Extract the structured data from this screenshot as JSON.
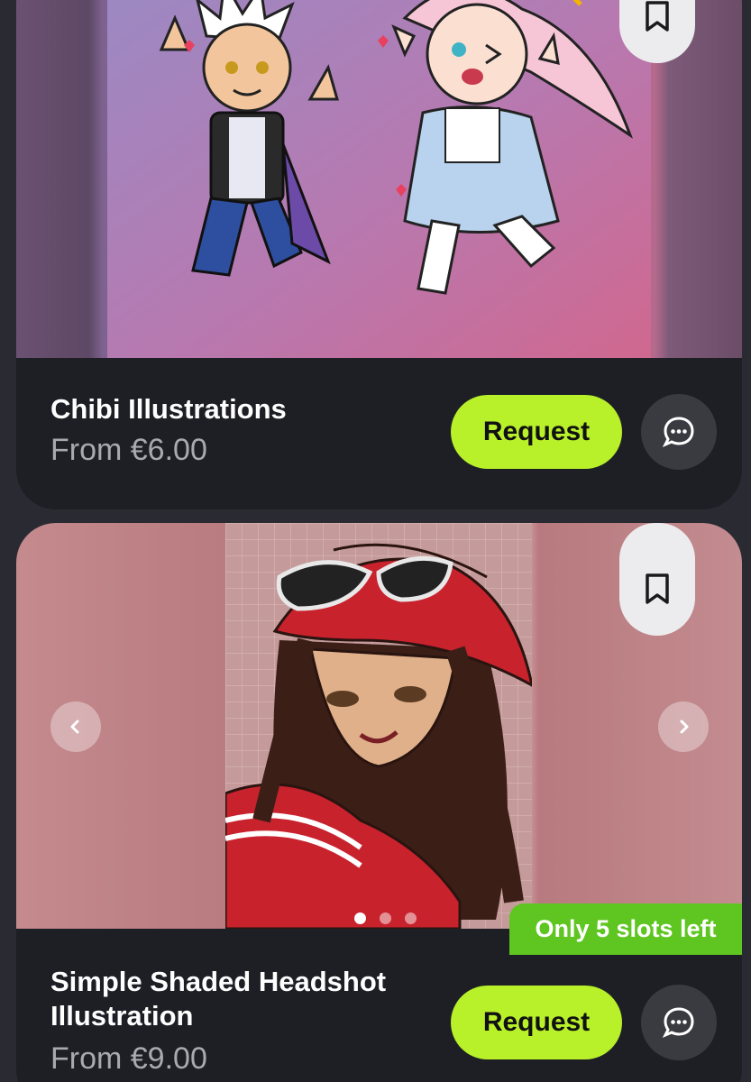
{
  "listings": [
    {
      "title": "Chibi Illustrations",
      "price": "From €6.00",
      "request_label": "Request",
      "icons": [
        "bookmark-icon",
        "chat-bubble-icon"
      ]
    },
    {
      "title": "Simple Shaded Headshot Illustration",
      "price": "From €9.00",
      "request_label": "Request",
      "badge": "Only 5 slots left",
      "carousel": {
        "slides": 3,
        "active_index": 0
      },
      "icons": [
        "bookmark-icon",
        "chevron-left-icon",
        "chevron-right-icon",
        "chat-bubble-icon"
      ]
    }
  ],
  "colors": {
    "accent": "#b8f02a",
    "badge": "#5fc621",
    "card_bg": "#1e1f25",
    "page_bg": "#2a2b32"
  }
}
